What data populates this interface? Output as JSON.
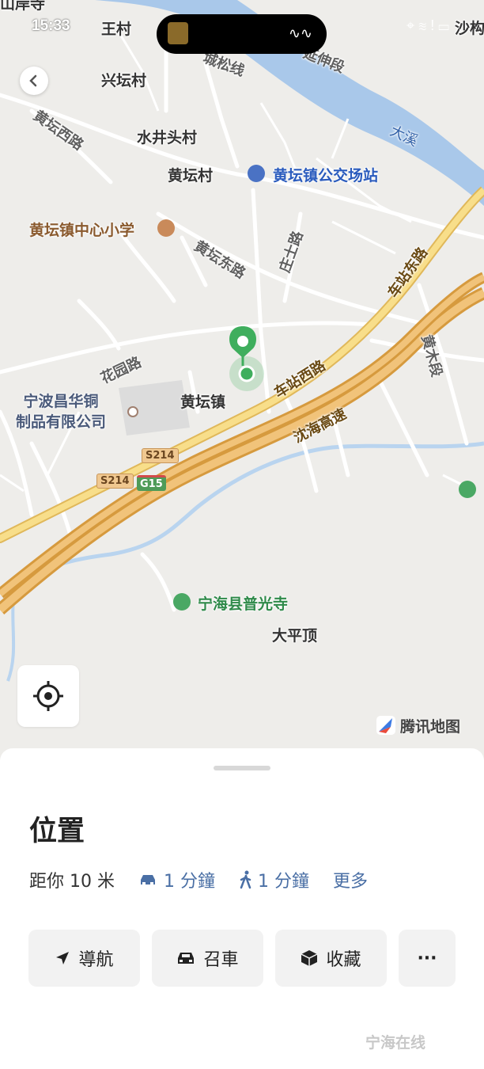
{
  "status_bar": {
    "time": "15:33"
  },
  "map": {
    "places": {
      "top_left": "山岸寺",
      "wangcun": "王村",
      "xingtan": "兴坛村",
      "shuijingtou": "水井头村",
      "huangtan_cun": "黄坛村",
      "huangtan_zhen": "黄坛镇",
      "dapingding": "大平顶",
      "shaxi": "沙构"
    },
    "roads": {
      "chengsong": "城松线",
      "yanshen": "延伸段",
      "huangtan_west": "黄坛西路",
      "huangtan_east": "黄坛东路",
      "zhuangshi": "庄士路",
      "chezhan_east": "车站东路",
      "huangmu": "黄木段",
      "huayuan": "花园路",
      "chezhan_west": "车站西路",
      "shenhai": "沈海高速"
    },
    "river": "大溪",
    "pois": {
      "bus_station": "黄坛镇公交场站",
      "school": "黄坛镇中心小学",
      "factory": "宁波昌华铜\n制品有限公司",
      "temple": "宁海县普光寺"
    },
    "shields": {
      "s214_a": "S214",
      "s214_b": "S214",
      "g15": "G15"
    },
    "attribution": "腾讯地图"
  },
  "sheet": {
    "title": "位置",
    "distance": "距你 10 米",
    "drive_time": "1 分鐘",
    "walk_time": "1 分鐘",
    "more": "更多",
    "actions": {
      "navigate": "導航",
      "taxi": "召車",
      "save": "收藏",
      "more": "···"
    }
  },
  "watermark": "宁海在线",
  "colors": {
    "pin": "#3fae5d",
    "accent_blue": "#4a6fa5",
    "highway": "#e7b05a",
    "river": "#a9c8ea"
  }
}
